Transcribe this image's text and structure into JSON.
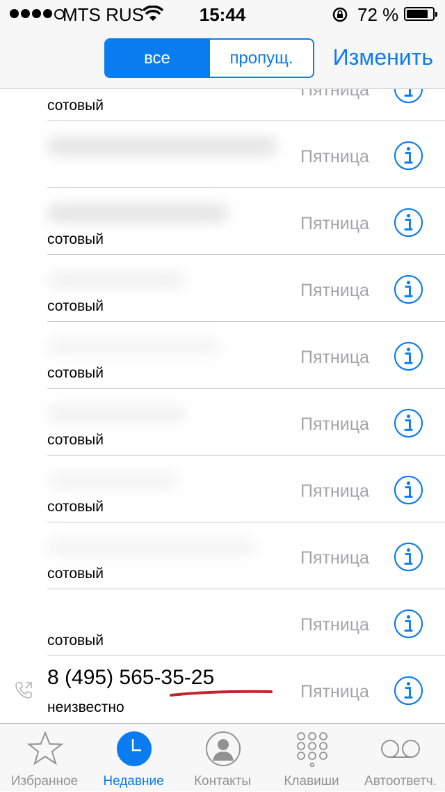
{
  "status_bar": {
    "carrier": "MTS RUS",
    "time": "15:44",
    "battery": "72 %",
    "battery_level": 0.72,
    "signal_bars": 4
  },
  "nav": {
    "segment_all": "все",
    "segment_missed": "пропущ.",
    "edit": "Изменить",
    "accent_color": "#0a7cf0"
  },
  "calls": [
    {
      "name": "",
      "type": "сотовый",
      "day": "Пятница"
    },
    {
      "name": "",
      "type": "",
      "day": "Пятница"
    },
    {
      "name": "",
      "type": "сотовый",
      "day": "Пятница"
    },
    {
      "name": "",
      "type": "сотовый",
      "day": "Пятница"
    },
    {
      "name": "",
      "type": "сотовый",
      "day": "Пятница"
    },
    {
      "name": "",
      "type": "сотовый",
      "day": "Пятница"
    },
    {
      "name": "",
      "type": "сотовый",
      "day": "Пятница"
    },
    {
      "name": "",
      "type": "сотовый",
      "day": "Пятница"
    },
    {
      "name": "",
      "type": "сотовый",
      "day": "Пятница"
    },
    {
      "name": "8 (495) 565-35-25",
      "type": "неизвестно",
      "day": "Пятница"
    }
  ],
  "tabs": [
    {
      "label": "Избранное",
      "icon": "star-icon"
    },
    {
      "label": "Недавние",
      "icon": "clock-icon"
    },
    {
      "label": "Контакты",
      "icon": "contact-icon"
    },
    {
      "label": "Клавиши",
      "icon": "keypad-icon"
    },
    {
      "label": "Автоответч.",
      "icon": "voicemail-icon"
    }
  ]
}
